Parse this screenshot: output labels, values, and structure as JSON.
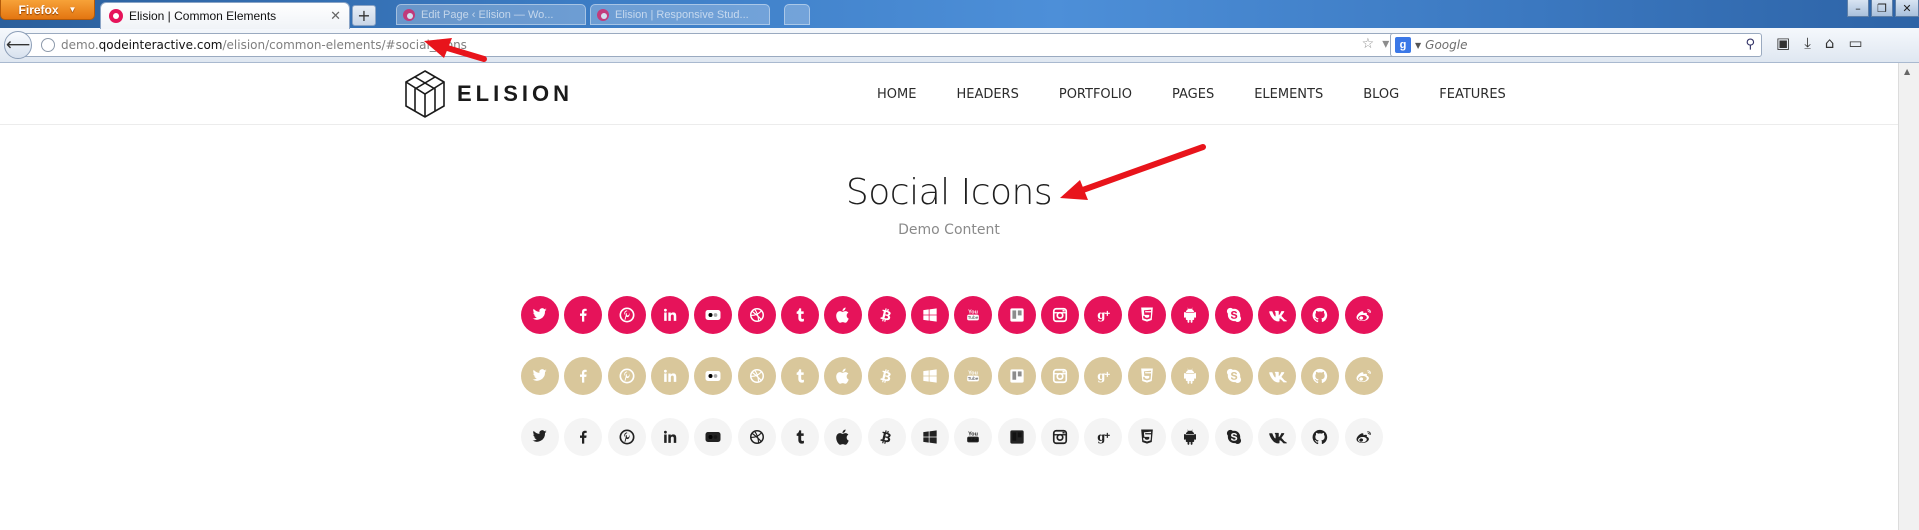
{
  "browser": {
    "menu_button": "Firefox",
    "active_tab": "Elision | Common Elements",
    "background_tabs": [
      "Edit Page ‹ Elision — Wo...",
      "Elision | Responsive Stud..."
    ],
    "url_host": "demo.qodeinteractive.com",
    "url_path": "/elision/common-elements/#social_icons",
    "search_placeholder": "Google"
  },
  "site": {
    "logo_text": "ELISION",
    "menu": [
      "HOME",
      "HEADERS",
      "PORTFOLIO",
      "PAGES",
      "ELEMENTS",
      "BLOG",
      "FEATURES"
    ]
  },
  "content": {
    "title": "Social Icons",
    "subtitle": "Demo Content"
  },
  "icons": [
    "twitter-icon",
    "facebook-icon",
    "pinterest-icon",
    "linkedin-icon",
    "flickr-icon",
    "dribbble-icon",
    "tumblr-icon",
    "apple-icon",
    "bitcoin-icon",
    "windows-icon",
    "youtube-icon",
    "trello-icon",
    "instagram-icon",
    "google-plus-icon",
    "html5-icon",
    "android-icon",
    "skype-icon",
    "vk-icon",
    "github-icon",
    "weibo-icon"
  ],
  "colors": {
    "accent_pink": "#e6135a",
    "accent_tan": "#d9c79b",
    "light_circle": "#f4f4f4",
    "annotation_arrow": "#e8141b"
  }
}
